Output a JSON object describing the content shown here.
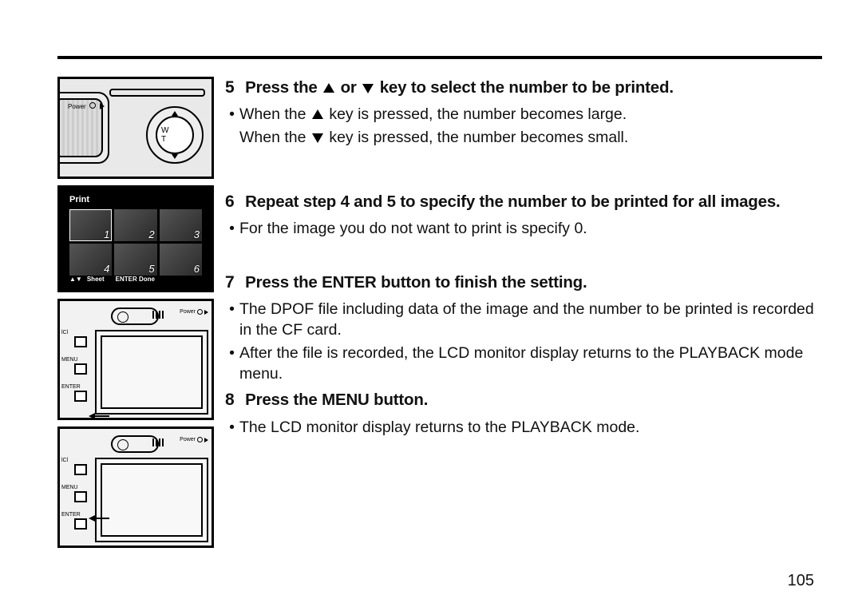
{
  "page_number": "105",
  "steps": {
    "s5": {
      "num": "5",
      "head_a": "Press the ",
      "head_b": " or ",
      "head_c": " key to select the number to be printed.",
      "b1_a": "When the ",
      "b1_b": " key is pressed, the number becomes large.",
      "b2_a": "When the ",
      "b2_b": " key is pressed, the number becomes small."
    },
    "s6": {
      "num": "6",
      "head": "Repeat step 4 and 5 to specify the number to be printed for all images.",
      "b1": "For the image you do not want to print is specify 0."
    },
    "s7": {
      "num": "7",
      "head": "Press the ENTER button to finish the setting.",
      "b1": "The DPOF file including data of the image and the number to be printed is recorded in the CF card.",
      "b2": "After the file is recorded, the LCD monitor display returns to the PLAYBACK mode menu."
    },
    "s8": {
      "num": "8",
      "head": "Press the MENU button.",
      "b1": "The LCD monitor display returns to the PLAYBACK mode."
    }
  },
  "fig1": {
    "power": "Power",
    "wt": "W T"
  },
  "fig2": {
    "title": "Print",
    "thumbs": [
      "1",
      "2",
      "3",
      "4",
      "5",
      "6"
    ],
    "foot_keys": "▲▼",
    "foot_sheet": "Sheet",
    "foot_enter": "ENTER Done"
  },
  "figback": {
    "power": "Power",
    "btn1": "lCl",
    "btn2": "MENU",
    "btn3": "ENTER"
  }
}
